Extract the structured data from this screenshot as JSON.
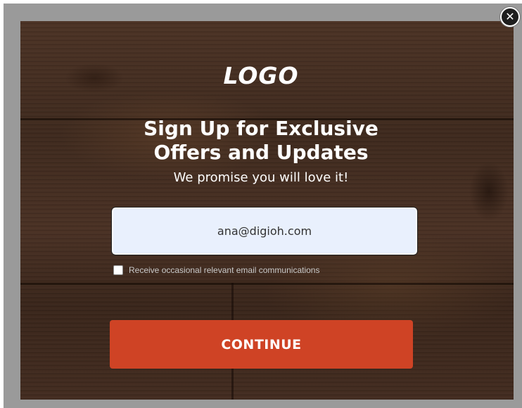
{
  "popup": {
    "close_glyph": "✕",
    "logo_text": "LOGO",
    "headline_line1": "Sign Up for Exclusive",
    "headline_line2": "Offers and Updates",
    "subline": "We promise you will love it!",
    "email_value": "ana@digioh.com",
    "consent_label": "Receive occasional relevant email communications",
    "consent_checked": false,
    "continue_label": "CONTINUE"
  },
  "colors": {
    "button": "#cf4325",
    "input_bg": "#e9f0fd",
    "wood_dark": "#3f2a1e"
  },
  "icons": {
    "close": "close-icon"
  }
}
